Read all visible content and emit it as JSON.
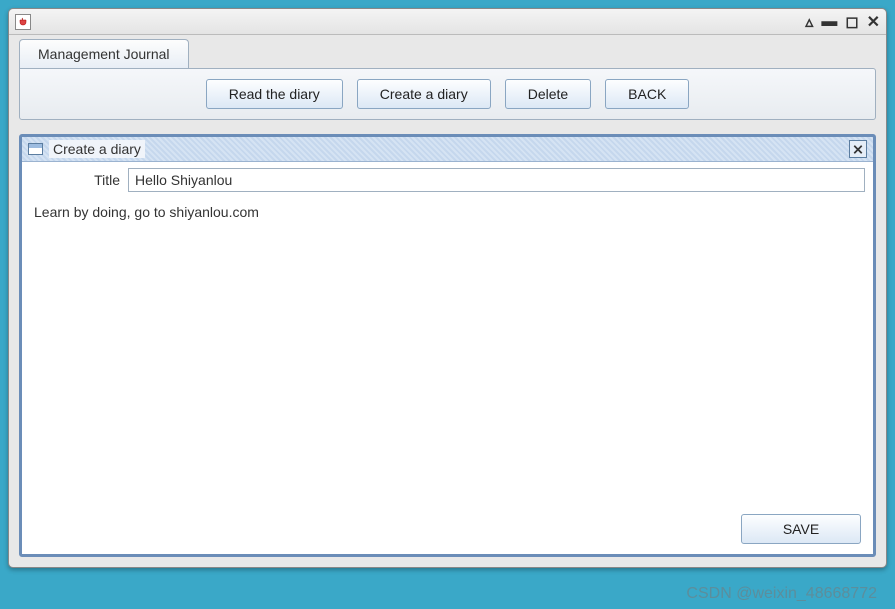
{
  "window": {
    "tab_label": "Management Journal"
  },
  "toolbar": {
    "read_label": "Read the diary",
    "create_label": "Create a diary",
    "delete_label": "Delete",
    "back_label": "BACK"
  },
  "internal_frame": {
    "title": "Create a diary",
    "title_label": "Title",
    "title_value": "Hello Shiyanlou",
    "body_value": "Learn by doing, go to shiyanlou.com",
    "save_label": "SAVE"
  },
  "watermark": "CSDN @weixin_48668772"
}
